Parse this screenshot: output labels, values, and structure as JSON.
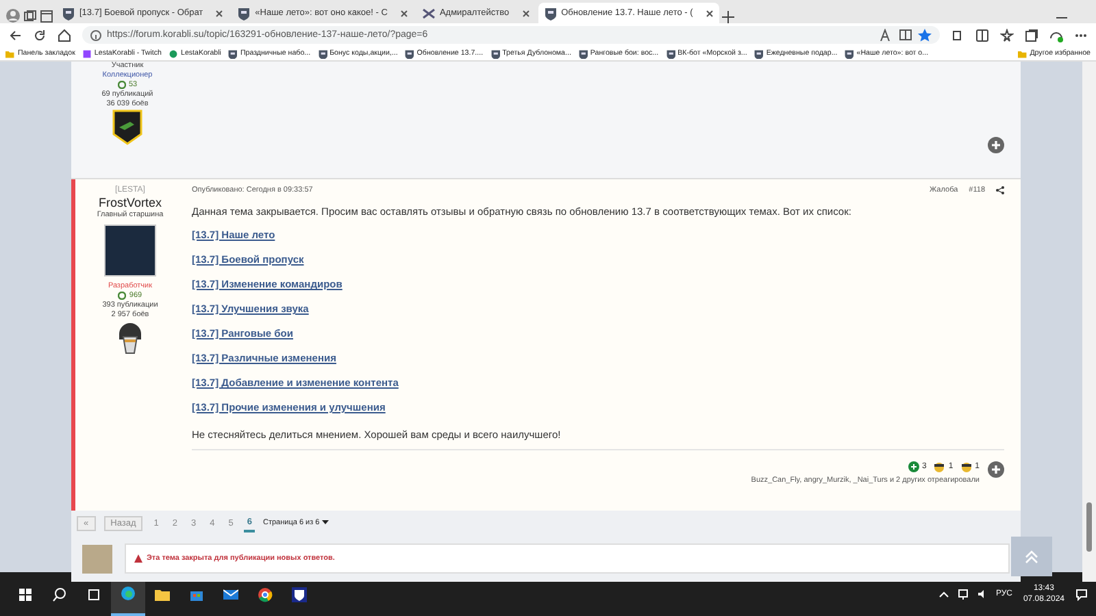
{
  "browser": {
    "tabs": [
      {
        "title": "[13.7] Боевой пропуск - Обрат",
        "selected": false
      },
      {
        "title": "«Наше лето»: вот оно какое! - С",
        "selected": false
      },
      {
        "title": "Адмиралтейство",
        "selected": false
      },
      {
        "title": "Обновление 13.7. Наше лето - (",
        "selected": true
      }
    ],
    "url": "https://forum.korabli.su/topic/163291-обновление-137-наше-лето/?page=6",
    "bookmarks": [
      "Панель закладок",
      "LestaKorabli - Twitch",
      "LestaKorabli",
      "Праздничные набо...",
      "Бонус коды,акции,...",
      "Обновление 13.7....",
      "Третья Дублонома...",
      "Ранговые бои: вос...",
      "ВК-бот «Морской з...",
      "Ежедневные подар...",
      "«Наше лето»: вот о..."
    ],
    "other_bookmarks": "Другое избранное"
  },
  "previous_post": {
    "rank": "Участник",
    "group": "Коллекционер",
    "reputation": "53",
    "posts_count": "69 публикаций",
    "battles": "36 039 боёв"
  },
  "post": {
    "tag": "[LESTA]",
    "author": "FrostVortex",
    "rank": "Главный старшина",
    "group": "Разработчик",
    "reputation": "969",
    "posts_count": "393 публикации",
    "battles": "2 957 боёв",
    "published": "Опубликовано: Сегодня в 09:33:57",
    "report": "Жалоба",
    "number": "#118",
    "intro": "Данная тема  закрывается. Просим вас оставлять отзывы и обратную связь по обновлению 13.7 в соответствующих темах. Вот их список:",
    "links": [
      "[13.7] Наше лето",
      "[13.7] Боевой пропуск",
      "[13.7] Изменение командиров",
      "[13.7] Улучшения звука",
      "[13.7] Ранговые бои",
      "[13.7] Различные изменения",
      "[13.7] Добавление и изменение контента",
      "[13.7] Прочие изменения и улучшения"
    ],
    "closing": "Не стесняйтесь делиться мнением. Хорошей вам среды и всего наилучшего!",
    "reactions": [
      {
        "kind": "plus",
        "count": "3"
      },
      {
        "kind": "face",
        "count": "1"
      },
      {
        "kind": "face",
        "count": "1"
      }
    ],
    "reacted": "Buzz_Can_Fly, angry_Murzik, _Nai_Turs и 2 других отреагировали"
  },
  "pager": {
    "first": "«",
    "prev": "Назад",
    "pages": [
      {
        "label": "1",
        "selected": false
      },
      {
        "label": "2",
        "selected": false
      },
      {
        "label": "3",
        "selected": false
      },
      {
        "label": "4",
        "selected": false
      },
      {
        "label": "5",
        "selected": false
      },
      {
        "label": "6",
        "selected": true
      }
    ],
    "page_info": "Страница 6 из 6"
  },
  "reply": {
    "notice": "Эта тема закрыта для публикации новых ответов."
  },
  "taskbar": {
    "language": "РУС",
    "time": "13:43",
    "date": "07.08.2024"
  }
}
